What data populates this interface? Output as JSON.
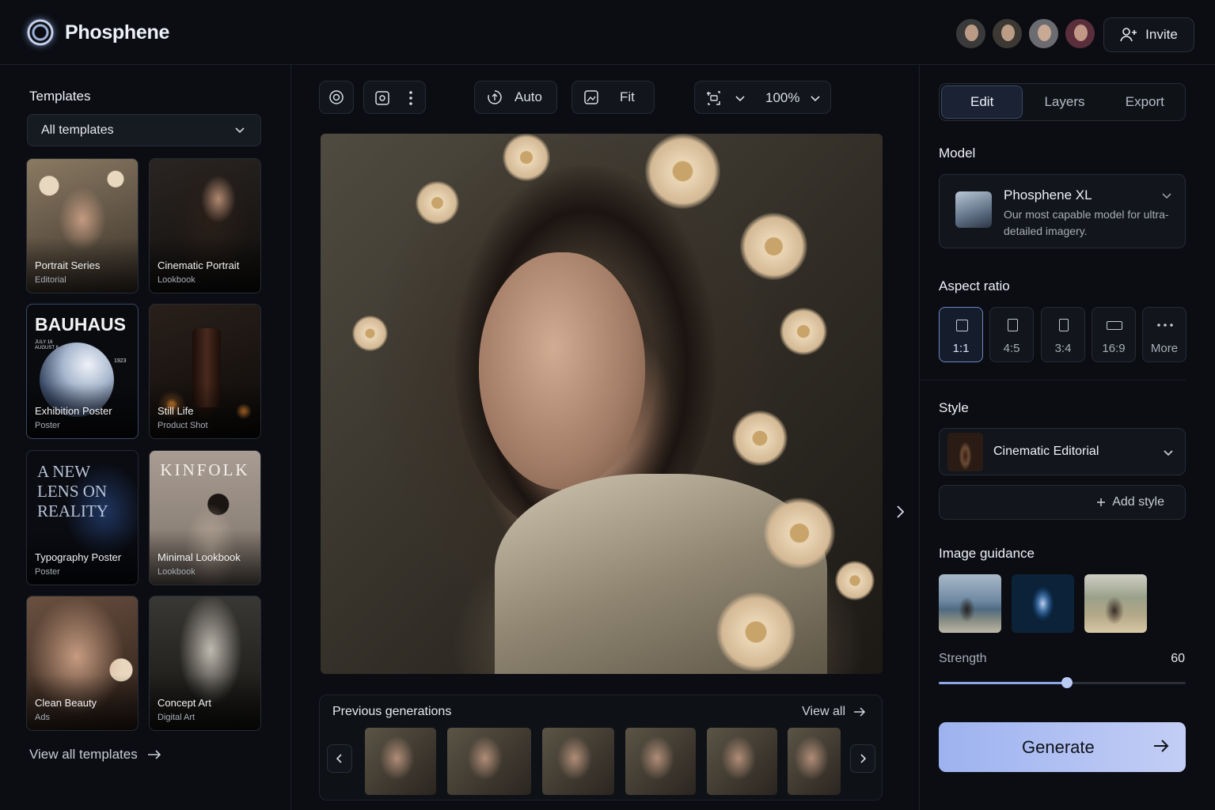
{
  "app": {
    "name": "Phosphene"
  },
  "header": {
    "avatars": [
      {
        "name": "user-avatar-1",
        "color": "#3a3a3a"
      },
      {
        "name": "user-avatar-2",
        "color": "#3c3833"
      },
      {
        "name": "user-avatar-3",
        "color": "#6b6b70"
      },
      {
        "name": "user-avatar-4",
        "color": "#5a2e3a"
      }
    ],
    "invite_label": "Invite"
  },
  "templates": {
    "title": "Templates",
    "filter_value": "All templates",
    "items": [
      {
        "title": "Portrait Series",
        "subtitle": "Editorial"
      },
      {
        "title": "Cinematic Portrait",
        "subtitle": "Lookbook"
      },
      {
        "title": "Exhibition Poster",
        "subtitle": "Poster",
        "art_text": "BAUHAUS",
        "art_date": "JULY 16\nAUGUST 6",
        "art_year": "1923"
      },
      {
        "title": "Still Life",
        "subtitle": "Product Shot"
      },
      {
        "title": "Typography Poster",
        "subtitle": "Poster",
        "art_text": "A NEW LENS ON REALITY"
      },
      {
        "title": "Minimal Lookbook",
        "subtitle": "Lookbook",
        "art_text": "KINFOLK"
      },
      {
        "title": "Clean Beauty",
        "subtitle": "Ads"
      },
      {
        "title": "Concept Art",
        "subtitle": "Digital Art"
      }
    ],
    "view_all": "View all templates"
  },
  "toolbar": {
    "auto_label": "Auto",
    "fit_label": "Fit",
    "zoom": "100%"
  },
  "previous": {
    "title": "Previous generations",
    "view_all": "View all",
    "count": 6
  },
  "panel": {
    "tabs": [
      "Edit",
      "Layers",
      "Export"
    ],
    "active_tab": "Edit",
    "model_section": "Model",
    "model": {
      "name": "Phosphene XL",
      "description": "Our most capable model for ultra-detailed imagery."
    },
    "aspect_section": "Aspect ratio",
    "ratios": [
      "1:1",
      "4:5",
      "3:4",
      "16:9",
      "More"
    ],
    "selected_ratio": "1:1",
    "style_section": "Style",
    "style_value": "Cinematic Editorial",
    "add_style": "Add style",
    "guidance_section": "Image guidance",
    "strength_label": "Strength",
    "strength_value": "60",
    "strength_fraction": 0.52,
    "generate_label": "Generate"
  },
  "colors": {
    "accent": "#9db2f0",
    "background": "#0b0d12"
  }
}
